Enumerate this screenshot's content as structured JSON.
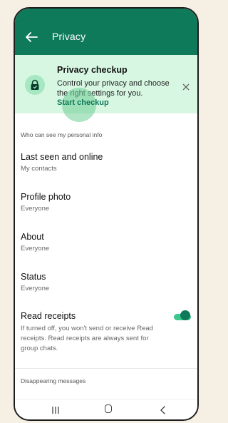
{
  "header": {
    "title": "Privacy"
  },
  "checkup": {
    "title": "Privacy checkup",
    "description": "Control your privacy and choose the right settings for you.",
    "link": "Start checkup"
  },
  "sections": {
    "personal_info": "Who can see my personal info",
    "disappearing": "Disappearing messages"
  },
  "items": [
    {
      "title": "Last seen and online",
      "value": "My contacts"
    },
    {
      "title": "Profile photo",
      "value": "Everyone"
    },
    {
      "title": "About",
      "value": "Everyone"
    },
    {
      "title": "Status",
      "value": "Everyone"
    }
  ],
  "read_receipts": {
    "title": "Read receipts",
    "description": "If turned off, you won't send or receive Read receipts. Read receipts are always sent for group chats.",
    "enabled": true
  },
  "icons": {
    "back": "arrow-left-icon",
    "lock": "lock-check-icon",
    "close": "close-icon",
    "nav_recents": "recents-icon",
    "nav_home": "home-icon",
    "nav_back": "chevron-left-icon"
  },
  "colors": {
    "primary": "#0f7a5a",
    "banner": "#d7f7e3",
    "toggle_track": "#3cc78c"
  }
}
